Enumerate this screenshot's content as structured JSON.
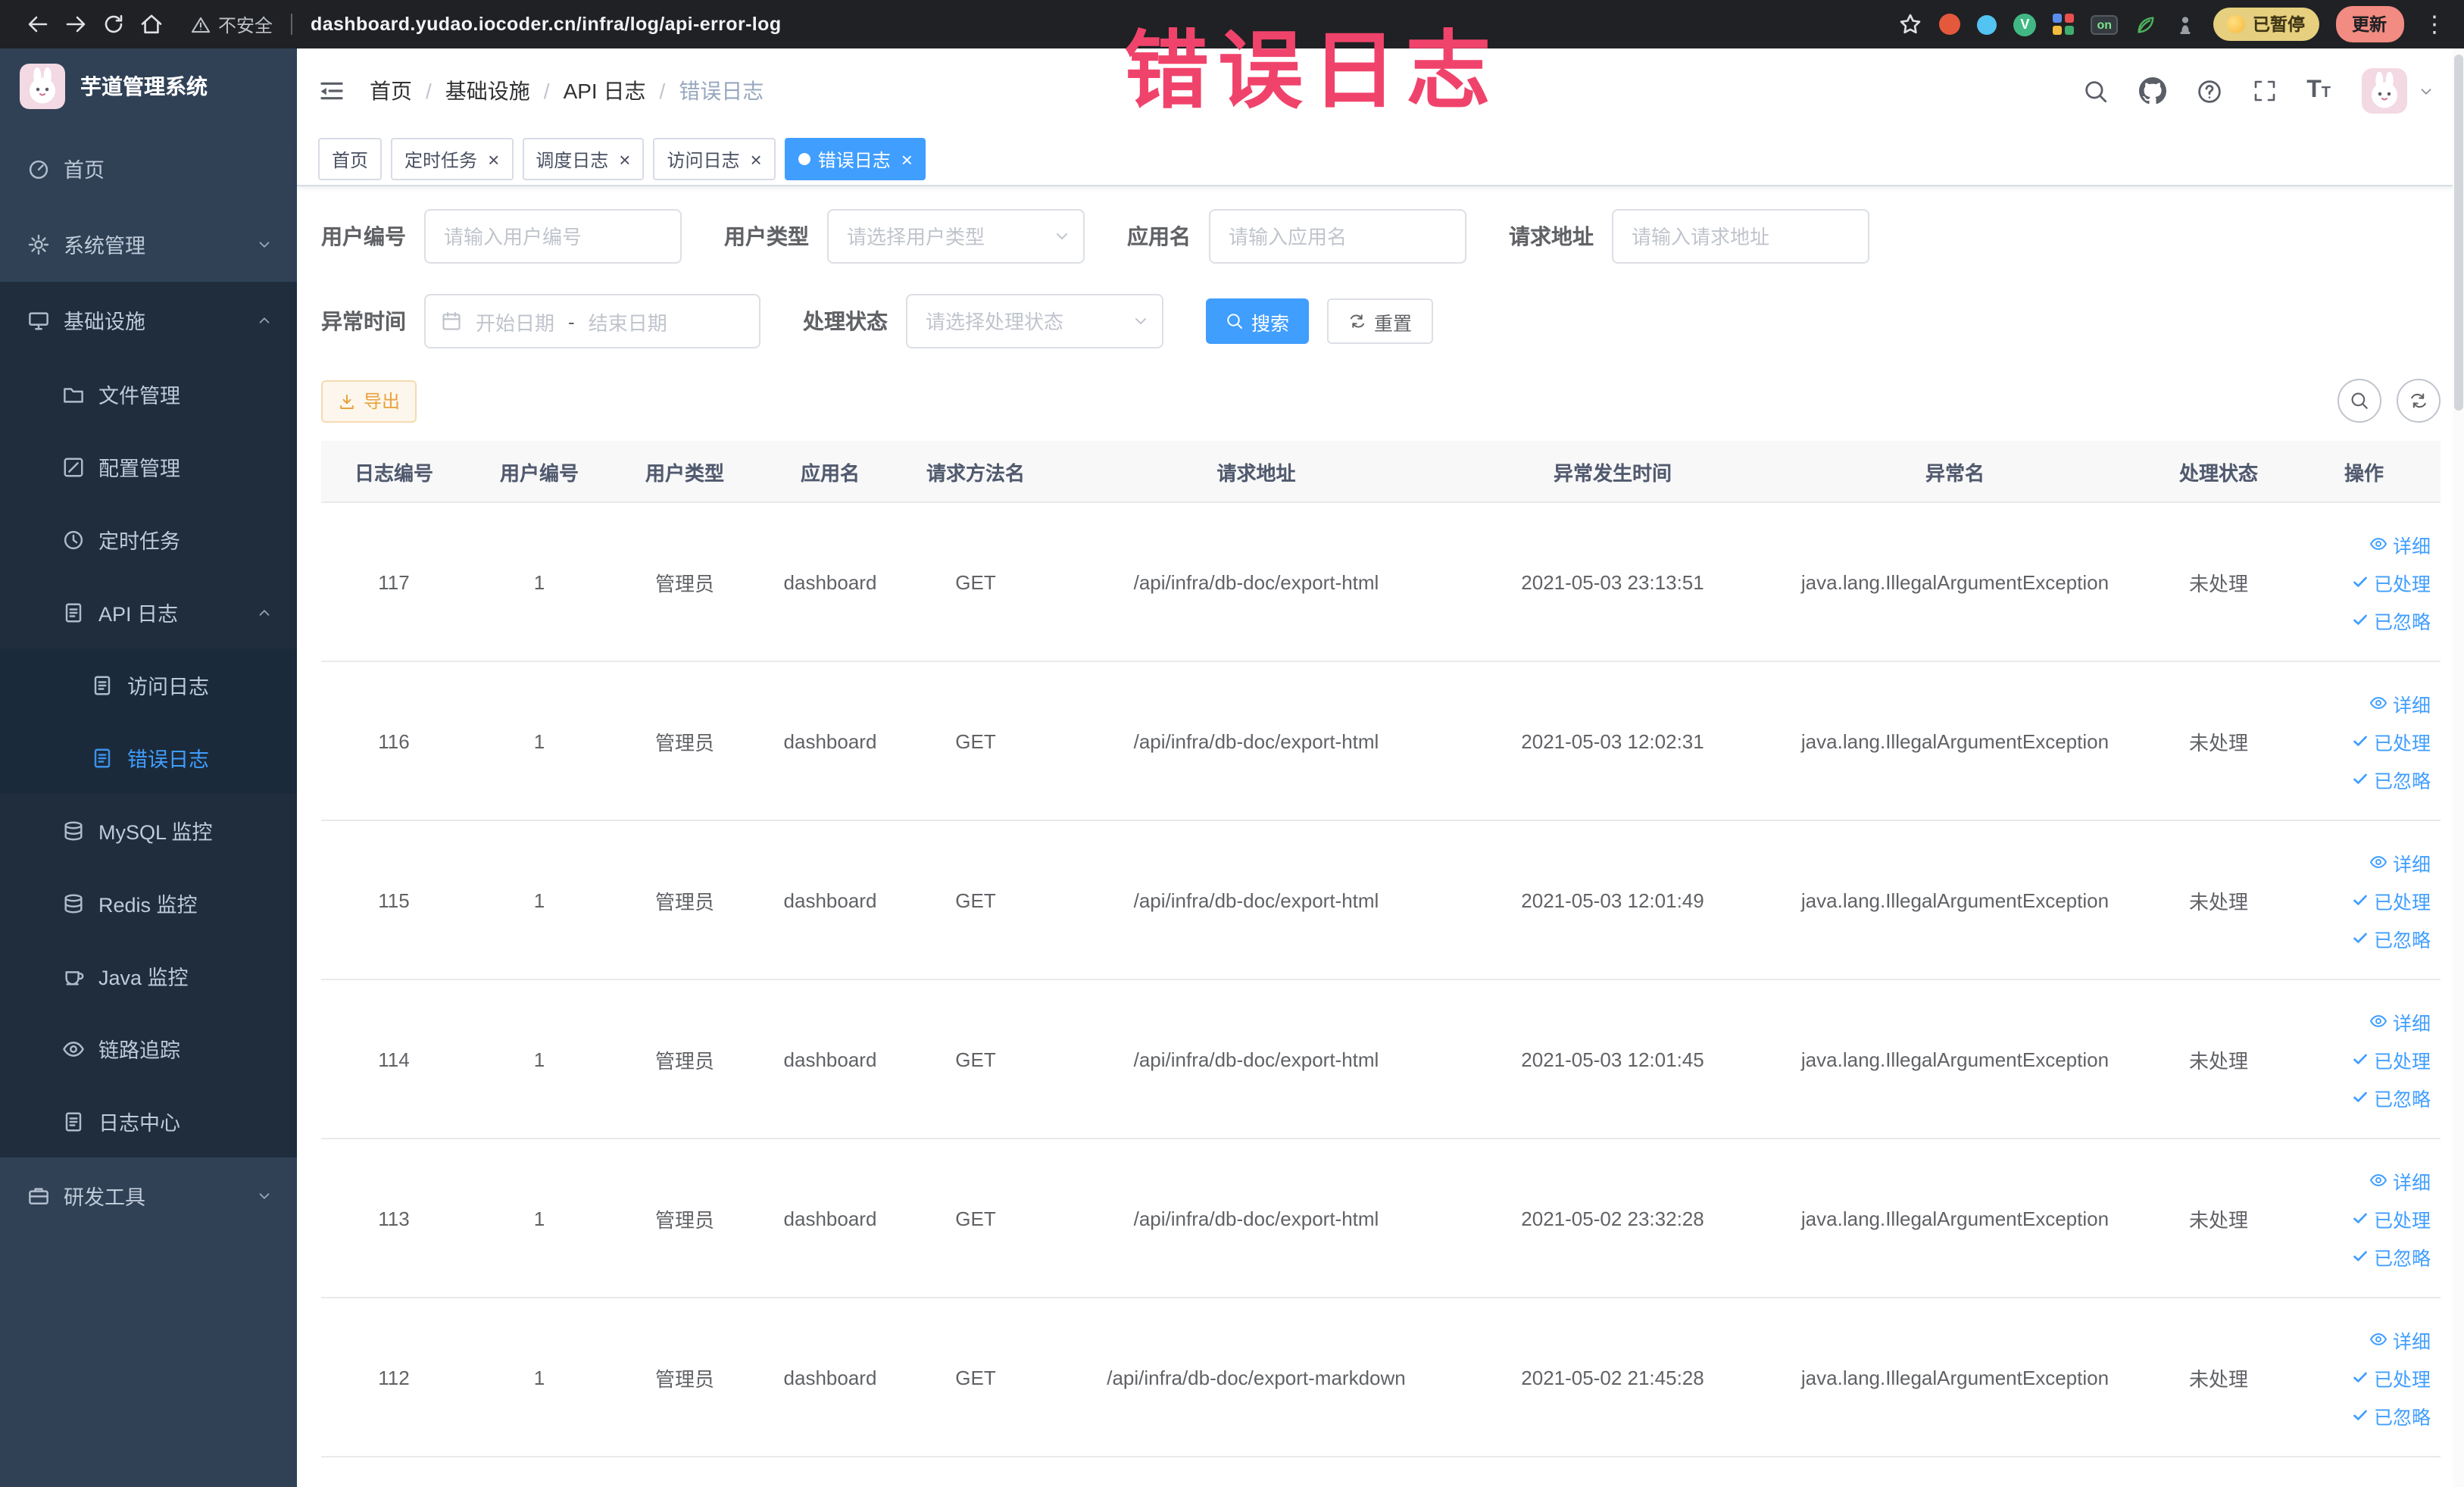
{
  "browser": {
    "security_label": "不安全",
    "url": "dashboard.yudao.iocoder.cn/infra/log/api-error-log",
    "paused_badge": "已暂停",
    "update_button": "更新",
    "ext_vue_letter": "V",
    "ext_switch_label": "on"
  },
  "annotation": {
    "text": "错误日志",
    "color": "#f0436b"
  },
  "sidebar": {
    "logo_title": "芋道管理系统",
    "items": [
      {
        "id": "home",
        "label": "首页",
        "level": 1,
        "icon": "dashboard"
      },
      {
        "id": "system",
        "label": "系统管理",
        "level": 1,
        "icon": "gear",
        "arrow": "down"
      },
      {
        "id": "infra",
        "label": "基础设施",
        "level": 1,
        "icon": "monitor",
        "arrow": "up",
        "open": true
      },
      {
        "id": "file",
        "label": "文件管理",
        "level": 2,
        "icon": "folder",
        "section": true
      },
      {
        "id": "config",
        "label": "配置管理",
        "level": 2,
        "icon": "edit",
        "section": true
      },
      {
        "id": "job",
        "label": "定时任务",
        "level": 2,
        "icon": "clock",
        "section": true
      },
      {
        "id": "api-log",
        "label": "API 日志",
        "level": 2,
        "icon": "doc",
        "arrow": "up",
        "open": true,
        "section": true
      },
      {
        "id": "access-log",
        "label": "访问日志",
        "level": 3,
        "icon": "doc",
        "section": true
      },
      {
        "id": "error-log",
        "label": "错误日志",
        "level": 3,
        "icon": "doc",
        "section": true,
        "active": true
      },
      {
        "id": "mysql",
        "label": "MySQL 监控",
        "level": 2,
        "icon": "db",
        "section": true
      },
      {
        "id": "redis",
        "label": "Redis 监控",
        "level": 2,
        "icon": "db",
        "section": true
      },
      {
        "id": "java",
        "label": "Java 监控",
        "level": 2,
        "icon": "cup",
        "section": true
      },
      {
        "id": "trace",
        "label": "链路追踪",
        "level": 2,
        "icon": "eye",
        "section": true
      },
      {
        "id": "log-center",
        "label": "日志中心",
        "level": 2,
        "icon": "doc",
        "section": true
      },
      {
        "id": "devtools",
        "label": "研发工具",
        "level": 1,
        "icon": "briefcase",
        "arrow": "down"
      }
    ]
  },
  "header": {
    "breadcrumb": [
      "首页",
      "基础设施",
      "API 日志",
      "错误日志"
    ]
  },
  "tabs": [
    {
      "label": "首页",
      "closable": false,
      "active": false
    },
    {
      "label": "定时任务",
      "closable": true,
      "active": false
    },
    {
      "label": "调度日志",
      "closable": true,
      "active": false
    },
    {
      "label": "访问日志",
      "closable": true,
      "active": false
    },
    {
      "label": "错误日志",
      "closable": true,
      "active": true
    }
  ],
  "filters": {
    "user_id": {
      "label": "用户编号",
      "placeholder": "请输入用户编号"
    },
    "user_type": {
      "label": "用户类型",
      "placeholder": "请选择用户类型"
    },
    "app_name": {
      "label": "应用名",
      "placeholder": "请输入应用名"
    },
    "request_url": {
      "label": "请求地址",
      "placeholder": "请输入请求地址"
    },
    "exception_time": {
      "label": "异常时间",
      "start_placeholder": "开始日期",
      "separator": "-",
      "end_placeholder": "结束日期"
    },
    "process_status": {
      "label": "处理状态",
      "placeholder": "请选择处理状态"
    },
    "search_button": "搜索",
    "reset_button": "重置"
  },
  "toolbar": {
    "export_button": "导出"
  },
  "table": {
    "columns": [
      {
        "key": "id",
        "label": "日志编号"
      },
      {
        "key": "userId",
        "label": "用户编号"
      },
      {
        "key": "userType",
        "label": "用户类型"
      },
      {
        "key": "app",
        "label": "应用名"
      },
      {
        "key": "method",
        "label": "请求方法名"
      },
      {
        "key": "url",
        "label": "请求地址"
      },
      {
        "key": "time",
        "label": "异常发生时间"
      },
      {
        "key": "exception",
        "label": "异常名"
      },
      {
        "key": "status",
        "label": "处理状态"
      },
      {
        "key": "actions",
        "label": "操作"
      }
    ],
    "row_actions": [
      {
        "label": "详细",
        "icon": "eye"
      },
      {
        "label": "已处理",
        "icon": "check"
      },
      {
        "label": "已忽略",
        "icon": "check"
      }
    ],
    "rows": [
      {
        "id": "117",
        "userId": "1",
        "userType": "管理员",
        "app": "dashboard",
        "method": "GET",
        "url": "/api/infra/db-doc/export-html",
        "time": "2021-05-03 23:13:51",
        "exception": "java.lang.IllegalArgumentException",
        "status": "未处理"
      },
      {
        "id": "116",
        "userId": "1",
        "userType": "管理员",
        "app": "dashboard",
        "method": "GET",
        "url": "/api/infra/db-doc/export-html",
        "time": "2021-05-03 12:02:31",
        "exception": "java.lang.IllegalArgumentException",
        "status": "未处理"
      },
      {
        "id": "115",
        "userId": "1",
        "userType": "管理员",
        "app": "dashboard",
        "method": "GET",
        "url": "/api/infra/db-doc/export-html",
        "time": "2021-05-03 12:01:49",
        "exception": "java.lang.IllegalArgumentException",
        "status": "未处理"
      },
      {
        "id": "114",
        "userId": "1",
        "userType": "管理员",
        "app": "dashboard",
        "method": "GET",
        "url": "/api/infra/db-doc/export-html",
        "time": "2021-05-03 12:01:45",
        "exception": "java.lang.IllegalArgumentException",
        "status": "未处理"
      },
      {
        "id": "113",
        "userId": "1",
        "userType": "管理员",
        "app": "dashboard",
        "method": "GET",
        "url": "/api/infra/db-doc/export-html",
        "time": "2021-05-02 23:32:28",
        "exception": "java.lang.IllegalArgumentException",
        "status": "未处理"
      },
      {
        "id": "112",
        "userId": "1",
        "userType": "管理员",
        "app": "dashboard",
        "method": "GET",
        "url": "/api/infra/db-doc/export-markdown",
        "time": "2021-05-02 21:45:28",
        "exception": "java.lang.IllegalArgumentException",
        "status": "未处理"
      }
    ]
  }
}
